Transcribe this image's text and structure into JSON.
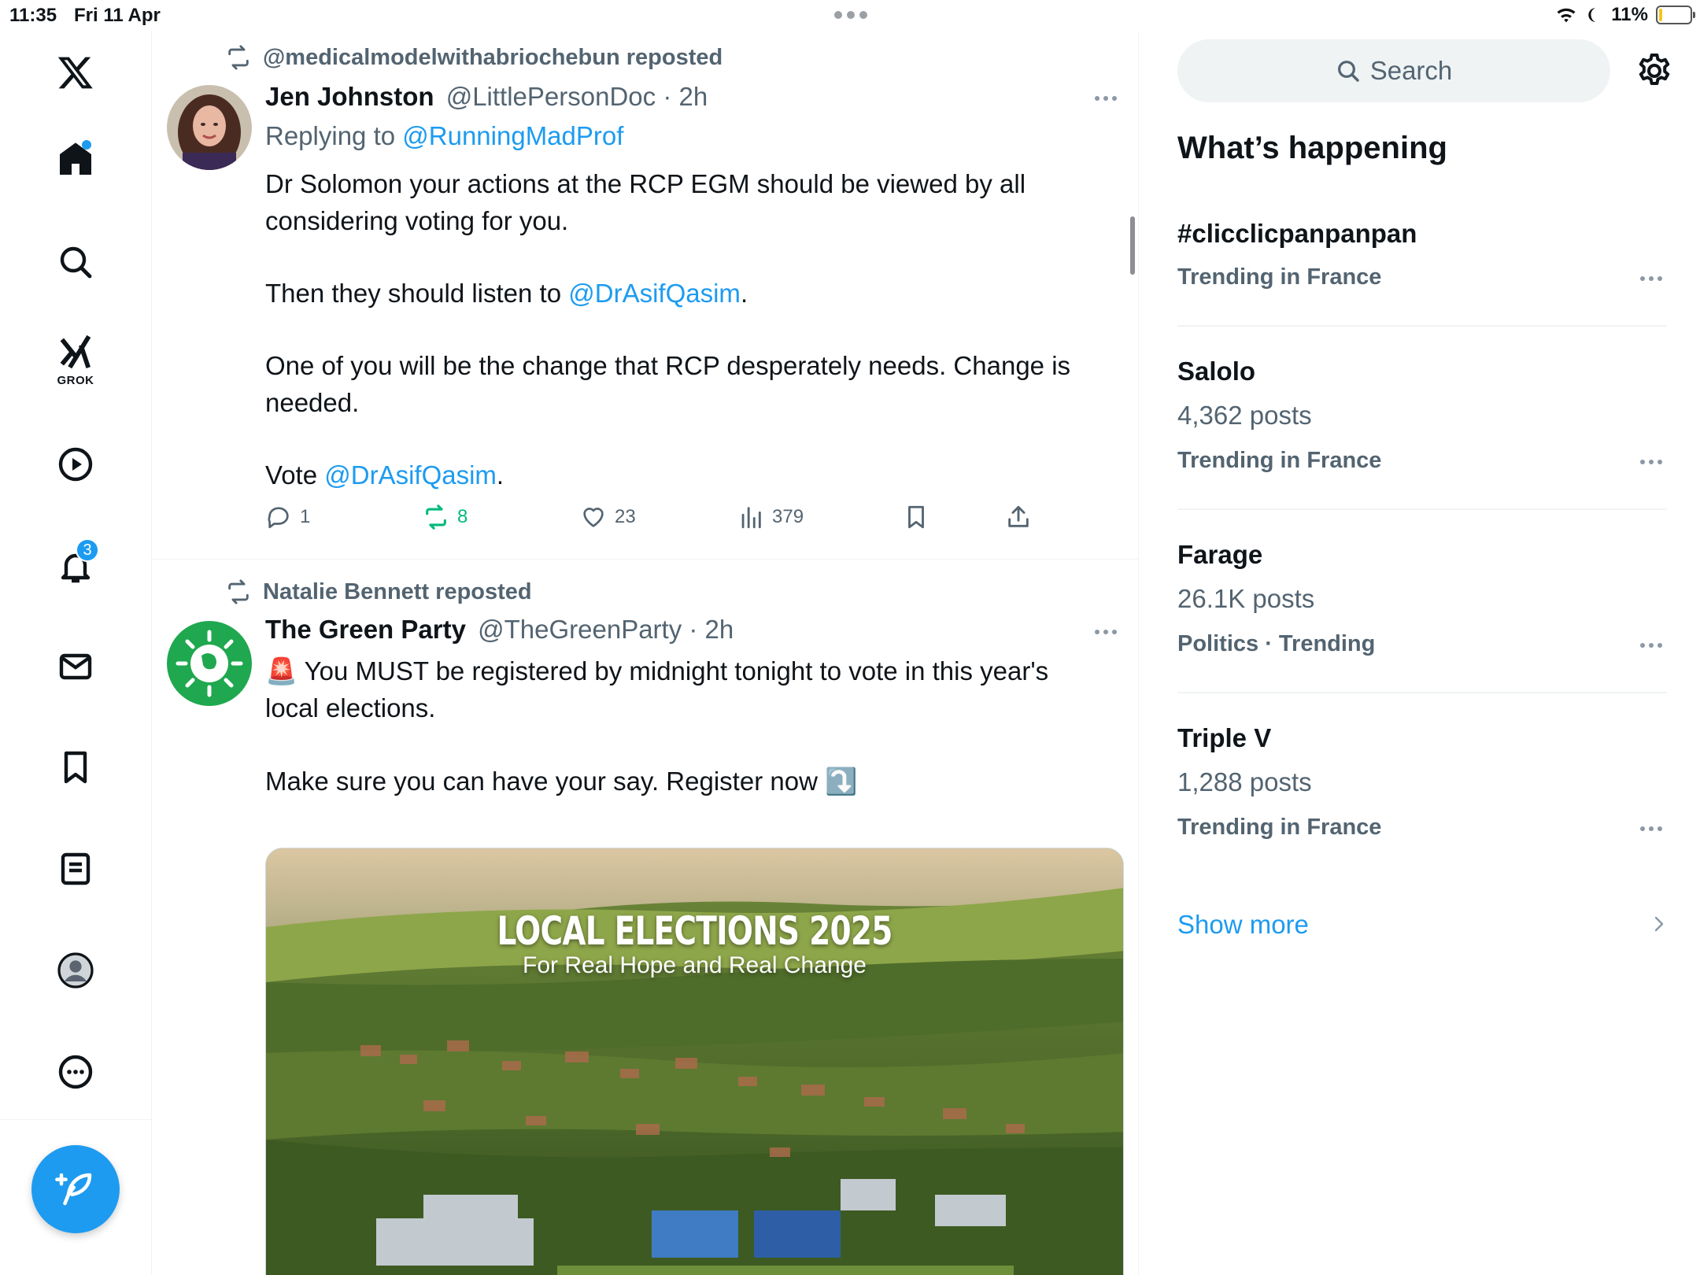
{
  "status_bar": {
    "time": "11:35",
    "date": "Fri 11 Apr",
    "battery": "11%",
    "battery_level": 0.11,
    "icons": [
      "wifi-icon",
      "moon-icon",
      "battery-charging-icon"
    ]
  },
  "nav": {
    "items": [
      {
        "name": "x-logo",
        "icon": "x-logo-icon"
      },
      {
        "name": "home",
        "icon": "home-icon"
      },
      {
        "name": "explore",
        "icon": "search-icon"
      },
      {
        "name": "grok",
        "icon": "grok-icon",
        "label": "GROK"
      },
      {
        "name": "videos",
        "icon": "play-icon"
      },
      {
        "name": "notifications",
        "icon": "bell-icon",
        "badge": "3"
      },
      {
        "name": "messages",
        "icon": "mail-icon"
      },
      {
        "name": "bookmarks",
        "icon": "bookmark-icon"
      },
      {
        "name": "lists",
        "icon": "list-icon"
      },
      {
        "name": "profile",
        "icon": "avatar-icon"
      },
      {
        "name": "more",
        "icon": "more-circle-icon"
      }
    ],
    "compose_icon": "compose-feather-icon"
  },
  "posts": [
    {
      "repost_by": "@medicalmodelwithabriochebun reposted",
      "author": "Jen Johnston",
      "handle": "@LittlePersonDoc · 2h",
      "reply_prefix": "Replying to ",
      "reply_to": "@RunningMadProf",
      "text": {
        "p1": "Dr Solomon your actions at the RCP EGM should be viewed by all considering voting for you.",
        "p2_before": "Then they should listen to ",
        "p2_mention": "@DrAsifQasim",
        "p2_after": ".",
        "p3": "One of you will be the change that RCP desperately needs. Change is needed.",
        "p4_before": "Vote ",
        "p4_mention": "@DrAsifQasim",
        "p4_after": "."
      },
      "stats": {
        "replies": "1",
        "reposts": "8",
        "likes": "23",
        "views": "379"
      }
    },
    {
      "repost_by": "Natalie Bennett reposted",
      "author": "The Green Party",
      "handle": "@TheGreenParty · 2h",
      "text": {
        "p1": "🚨 You MUST be registered by midnight tonight to vote in this year's local elections.",
        "p2": "Make sure you can have your say. Register now ⤵️"
      },
      "media": {
        "title": "LOCAL ELECTIONS 2025",
        "subtitle": "For Real Hope and Real Change"
      }
    }
  ],
  "sidebar": {
    "search_placeholder": "Search",
    "section_title": "What’s happening",
    "trends": [
      {
        "name": "#clicclicpanpanpan",
        "posts": "",
        "meta": "Trending in France"
      },
      {
        "name": "Salolo",
        "posts": "4,362 posts",
        "meta": "Trending in France"
      },
      {
        "name": "Farage",
        "posts": "26.1K posts",
        "meta": "Politics · Trending"
      },
      {
        "name": "Triple V",
        "posts": "1,288 posts",
        "meta": "Trending in France"
      }
    ],
    "show_more": "Show more"
  },
  "colors": {
    "accent": "#1d9bf0",
    "text_primary": "#0f1419",
    "text_secondary": "#536471",
    "repost_green": "#00ba7c",
    "green_party": "#1fa84f"
  }
}
